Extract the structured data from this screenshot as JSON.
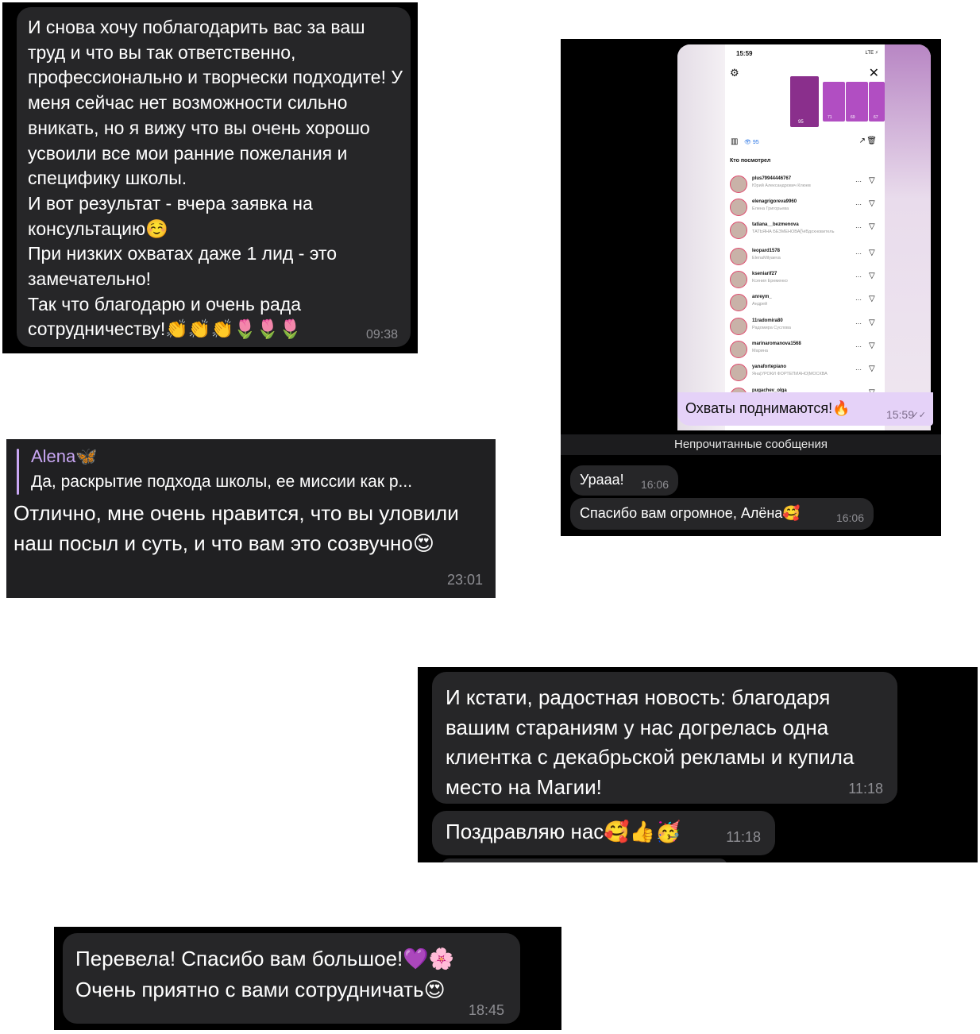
{
  "shot1": {
    "message": "И снова хочу поблагодарить вас за ваш труд и что вы так ответственно, профессионально и творчески подходите! У меня сейчас нет возможности сильно вникать, но я вижу что вы очень хорошо усвоили все мои ранние пожелания и специфику школы.\nИ вот результат - вчера заявка на консультацию☺️\nПри низких охватах даже 1 лид - это замечательно!\nТак что благодарю и очень рада сотрудничеству!👏👏👏🌷🌷🌷",
    "time": "09:38"
  },
  "shot2": {
    "reply_name": "Alena🦋",
    "reply_text": "Да, раскрытие подхода школы, ее миссии как р...",
    "message": "Отлично, мне очень нравится, что вы уловили наш посыл и суть, и что вам это созвучно😍",
    "time": "23:01"
  },
  "shot3": {
    "status_time": "15:59",
    "status_right": "LTE ⚡",
    "views": "95",
    "story_views": [
      "95",
      "71",
      "69",
      "67"
    ],
    "viewed_label": "Кто посмотрел",
    "viewers": [
      {
        "username": "plus79944446767",
        "name": "Юрий Александрович Клюев"
      },
      {
        "username": "elenagrigoreva9960",
        "name": "Елена Григорьева"
      },
      {
        "username": "tatiana__bezmenova",
        "name": "ТАТЬЯНА БЕЗМЕНОВА🌬Вдохновитель"
      },
      {
        "username": "leopard1578",
        "name": "ElenaMilyaeva"
      },
      {
        "username": "kseniarif27",
        "name": "Ксения Еременко"
      },
      {
        "username": "anreym_",
        "name": "Андрей"
      },
      {
        "username": "11radomira80",
        "name": "Радомира Суслова"
      },
      {
        "username": "marinaromanova1568",
        "name": "Марина"
      },
      {
        "username": "yanafortepiano",
        "name": "Яна|УРОКИ ФОРТЕПИАНО|МОСКВА"
      },
      {
        "username": "pugachev_olga",
        "name": ""
      }
    ],
    "outgoing": "Охваты поднимаются!🔥",
    "outgoing_time": "15:59",
    "unread_label": "Непрочитанные сообщения",
    "incoming1": "Урааа!",
    "incoming1_time": "16:06",
    "incoming2": "Спасибо вам огромное, Алёна🥰",
    "incoming2_time": "16:06"
  },
  "shot4": {
    "message1": "И кстати, радостная новость: благодаря вашим стараниям у нас догрелась одна клиентка с декабрьской рекламы и купила место на Магии!",
    "time1": "11:18",
    "message2": "Поздравляю нас🥰👍🥳",
    "time2": "11:18"
  },
  "shot5": {
    "message": "Перевела! Спасибо вам большое!💜🌸\nОчень приятно с вами сотрудничать😍",
    "time": "18:45"
  },
  "colors": {
    "bubble": "#262628",
    "time": "#8e8e93",
    "accent": "#c9a7f4",
    "outgoing_bubble": "#e5d2f8"
  }
}
